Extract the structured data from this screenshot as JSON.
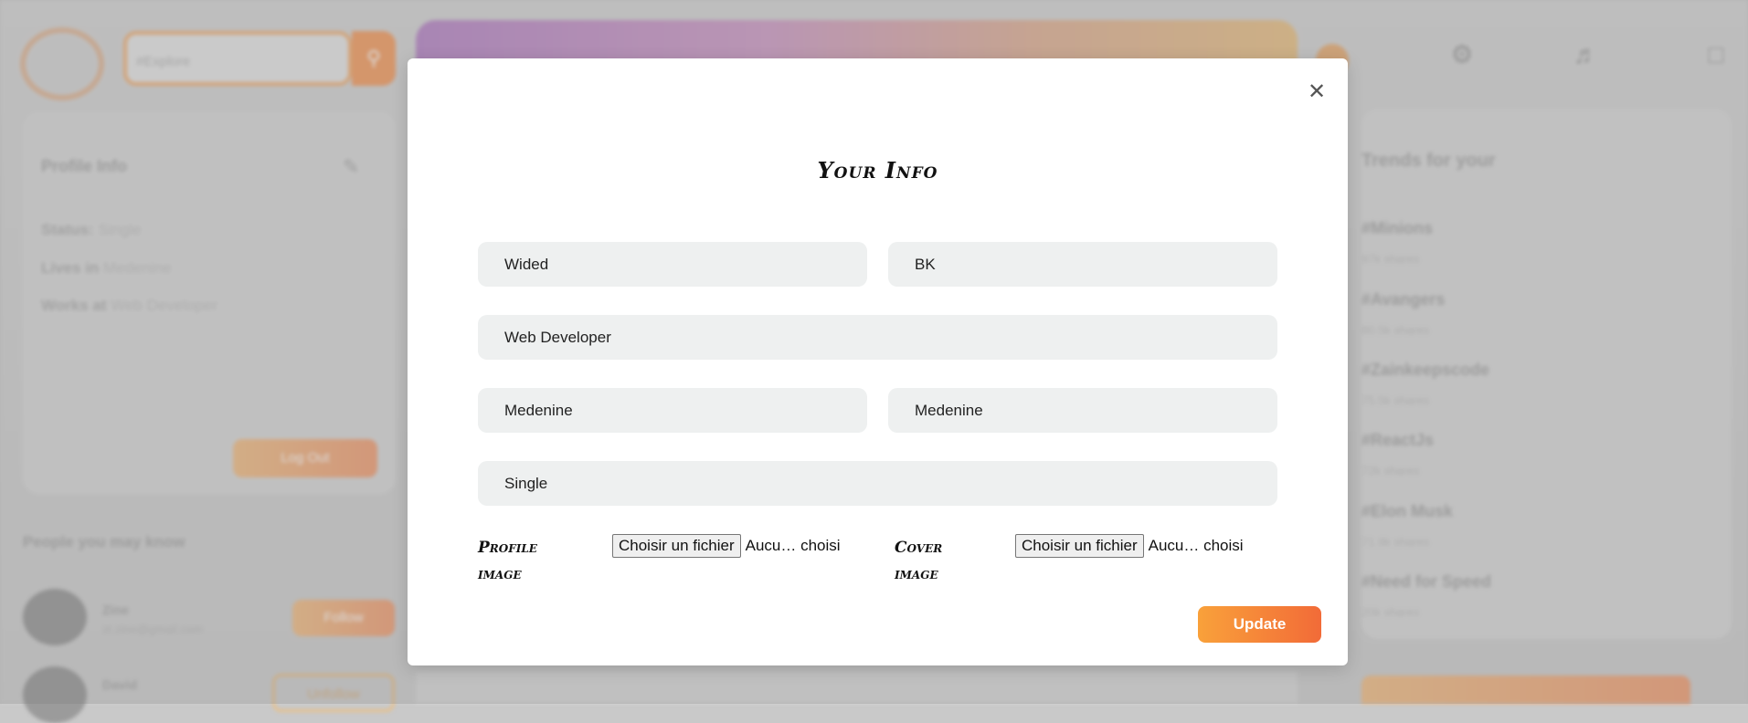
{
  "background": {
    "search_placeholder": "#Explore",
    "profile_card": {
      "title": "Profile Info",
      "status_label": "Status:",
      "status_value": "Single",
      "lives_label": "Lives in",
      "lives_value": "Medenine",
      "works_label": "Works at",
      "works_value": "Web Developer",
      "logout_label": "Log Out"
    },
    "people_title": "People you may know",
    "people": [
      {
        "name": "Zine",
        "email": "zt.zine@gmail.com",
        "action": "Follow"
      },
      {
        "name": "David",
        "email": "",
        "action": "Unfollow"
      }
    ],
    "trends_title": "Trends for your",
    "trends": [
      {
        "tag": "#Minions",
        "shares": "97k shares"
      },
      {
        "tag": "#Avangers",
        "shares": "80.5k shares"
      },
      {
        "tag": "#Zainkeepscode",
        "shares": "75.5k shares"
      },
      {
        "tag": "#ReactJs",
        "shares": "72k shares"
      },
      {
        "tag": "#Elon Musk",
        "shares": "71.9k shares"
      },
      {
        "tag": "#Need for Speed",
        "shares": "20k shares"
      }
    ],
    "accent_color": "#f0a27a"
  },
  "modal": {
    "title": "Your Info",
    "close_icon": "close-icon",
    "fields": {
      "first_name": "Wided",
      "last_name": "BK",
      "works_at": "Web Developer",
      "lives_in": "Medenine",
      "country": "Medenine",
      "relationship": "Single"
    },
    "profile_image_label": "Profile image",
    "cover_image_label": "Cover image",
    "file_button_label": "Choisir un fichier",
    "file_status": "Aucu… choisi",
    "update_label": "Update",
    "update_gradient": [
      "#f9a13a",
      "#f26b38"
    ]
  }
}
